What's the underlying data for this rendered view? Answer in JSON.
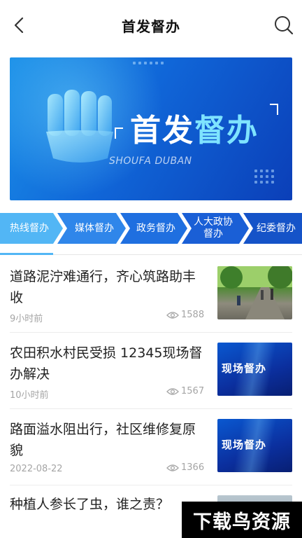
{
  "header": {
    "title": "首发督办"
  },
  "banner": {
    "title_main": "首发",
    "title_accent": "督办",
    "subtitle": "SHOUFA DUBAN"
  },
  "tabs": [
    {
      "label": "热线督办",
      "active": true
    },
    {
      "label": "媒体督办",
      "active": false
    },
    {
      "label": "政务督办",
      "active": false
    },
    {
      "label": "人大政协督办",
      "active": false
    },
    {
      "label": "纪委督办",
      "active": false
    }
  ],
  "news": [
    {
      "title": "道路泥泞难通行，齐心筑路助丰收",
      "time": "9小时前",
      "views": "1588",
      "thumb": "road-photo"
    },
    {
      "title": "农田积水村民受损 12345现场督办解决",
      "time": "10小时前",
      "views": "1567",
      "thumb": "现场督办"
    },
    {
      "title": "路面溢水阻出行，社区维修复原貌",
      "time": "2022-08-22",
      "views": "1366",
      "thumb": "现场督办"
    },
    {
      "title": "种植人参长了虫，谁之责？",
      "time": "",
      "views": "",
      "thumb": ""
    }
  ],
  "watermark": "下载鸟资源",
  "colors": {
    "tab_active": "#52b6f5",
    "tab_blue": "#1e6ee0",
    "tab_dark": "#1553c8"
  }
}
